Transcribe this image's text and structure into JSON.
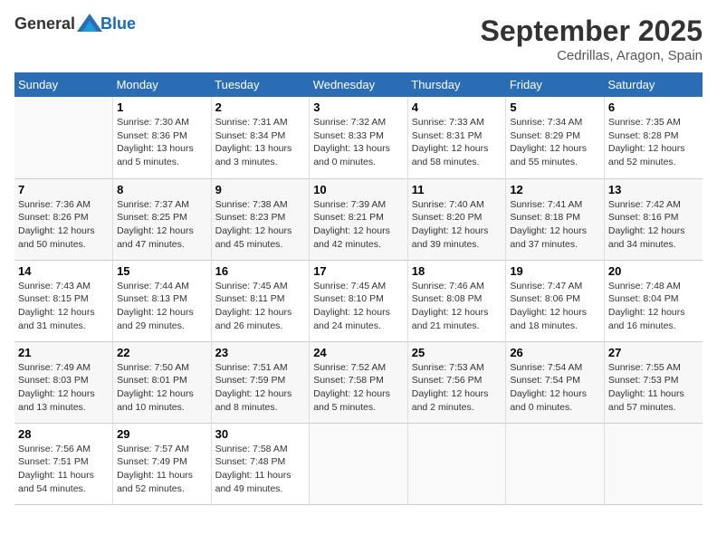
{
  "header": {
    "logo_general": "General",
    "logo_blue": "Blue",
    "month": "September 2025",
    "location": "Cedrillas, Aragon, Spain"
  },
  "days_of_week": [
    "Sunday",
    "Monday",
    "Tuesday",
    "Wednesday",
    "Thursday",
    "Friday",
    "Saturday"
  ],
  "weeks": [
    [
      {
        "day": "",
        "info": ""
      },
      {
        "day": "1",
        "info": "Sunrise: 7:30 AM\nSunset: 8:36 PM\nDaylight: 13 hours\nand 5 minutes."
      },
      {
        "day": "2",
        "info": "Sunrise: 7:31 AM\nSunset: 8:34 PM\nDaylight: 13 hours\nand 3 minutes."
      },
      {
        "day": "3",
        "info": "Sunrise: 7:32 AM\nSunset: 8:33 PM\nDaylight: 13 hours\nand 0 minutes."
      },
      {
        "day": "4",
        "info": "Sunrise: 7:33 AM\nSunset: 8:31 PM\nDaylight: 12 hours\nand 58 minutes."
      },
      {
        "day": "5",
        "info": "Sunrise: 7:34 AM\nSunset: 8:29 PM\nDaylight: 12 hours\nand 55 minutes."
      },
      {
        "day": "6",
        "info": "Sunrise: 7:35 AM\nSunset: 8:28 PM\nDaylight: 12 hours\nand 52 minutes."
      }
    ],
    [
      {
        "day": "7",
        "info": "Sunrise: 7:36 AM\nSunset: 8:26 PM\nDaylight: 12 hours\nand 50 minutes."
      },
      {
        "day": "8",
        "info": "Sunrise: 7:37 AM\nSunset: 8:25 PM\nDaylight: 12 hours\nand 47 minutes."
      },
      {
        "day": "9",
        "info": "Sunrise: 7:38 AM\nSunset: 8:23 PM\nDaylight: 12 hours\nand 45 minutes."
      },
      {
        "day": "10",
        "info": "Sunrise: 7:39 AM\nSunset: 8:21 PM\nDaylight: 12 hours\nand 42 minutes."
      },
      {
        "day": "11",
        "info": "Sunrise: 7:40 AM\nSunset: 8:20 PM\nDaylight: 12 hours\nand 39 minutes."
      },
      {
        "day": "12",
        "info": "Sunrise: 7:41 AM\nSunset: 8:18 PM\nDaylight: 12 hours\nand 37 minutes."
      },
      {
        "day": "13",
        "info": "Sunrise: 7:42 AM\nSunset: 8:16 PM\nDaylight: 12 hours\nand 34 minutes."
      }
    ],
    [
      {
        "day": "14",
        "info": "Sunrise: 7:43 AM\nSunset: 8:15 PM\nDaylight: 12 hours\nand 31 minutes."
      },
      {
        "day": "15",
        "info": "Sunrise: 7:44 AM\nSunset: 8:13 PM\nDaylight: 12 hours\nand 29 minutes."
      },
      {
        "day": "16",
        "info": "Sunrise: 7:45 AM\nSunset: 8:11 PM\nDaylight: 12 hours\nand 26 minutes."
      },
      {
        "day": "17",
        "info": "Sunrise: 7:45 AM\nSunset: 8:10 PM\nDaylight: 12 hours\nand 24 minutes."
      },
      {
        "day": "18",
        "info": "Sunrise: 7:46 AM\nSunset: 8:08 PM\nDaylight: 12 hours\nand 21 minutes."
      },
      {
        "day": "19",
        "info": "Sunrise: 7:47 AM\nSunset: 8:06 PM\nDaylight: 12 hours\nand 18 minutes."
      },
      {
        "day": "20",
        "info": "Sunrise: 7:48 AM\nSunset: 8:04 PM\nDaylight: 12 hours\nand 16 minutes."
      }
    ],
    [
      {
        "day": "21",
        "info": "Sunrise: 7:49 AM\nSunset: 8:03 PM\nDaylight: 12 hours\nand 13 minutes."
      },
      {
        "day": "22",
        "info": "Sunrise: 7:50 AM\nSunset: 8:01 PM\nDaylight: 12 hours\nand 10 minutes."
      },
      {
        "day": "23",
        "info": "Sunrise: 7:51 AM\nSunset: 7:59 PM\nDaylight: 12 hours\nand 8 minutes."
      },
      {
        "day": "24",
        "info": "Sunrise: 7:52 AM\nSunset: 7:58 PM\nDaylight: 12 hours\nand 5 minutes."
      },
      {
        "day": "25",
        "info": "Sunrise: 7:53 AM\nSunset: 7:56 PM\nDaylight: 12 hours\nand 2 minutes."
      },
      {
        "day": "26",
        "info": "Sunrise: 7:54 AM\nSunset: 7:54 PM\nDaylight: 12 hours\nand 0 minutes."
      },
      {
        "day": "27",
        "info": "Sunrise: 7:55 AM\nSunset: 7:53 PM\nDaylight: 11 hours\nand 57 minutes."
      }
    ],
    [
      {
        "day": "28",
        "info": "Sunrise: 7:56 AM\nSunset: 7:51 PM\nDaylight: 11 hours\nand 54 minutes."
      },
      {
        "day": "29",
        "info": "Sunrise: 7:57 AM\nSunset: 7:49 PM\nDaylight: 11 hours\nand 52 minutes."
      },
      {
        "day": "30",
        "info": "Sunrise: 7:58 AM\nSunset: 7:48 PM\nDaylight: 11 hours\nand 49 minutes."
      },
      {
        "day": "",
        "info": ""
      },
      {
        "day": "",
        "info": ""
      },
      {
        "day": "",
        "info": ""
      },
      {
        "day": "",
        "info": ""
      }
    ]
  ]
}
